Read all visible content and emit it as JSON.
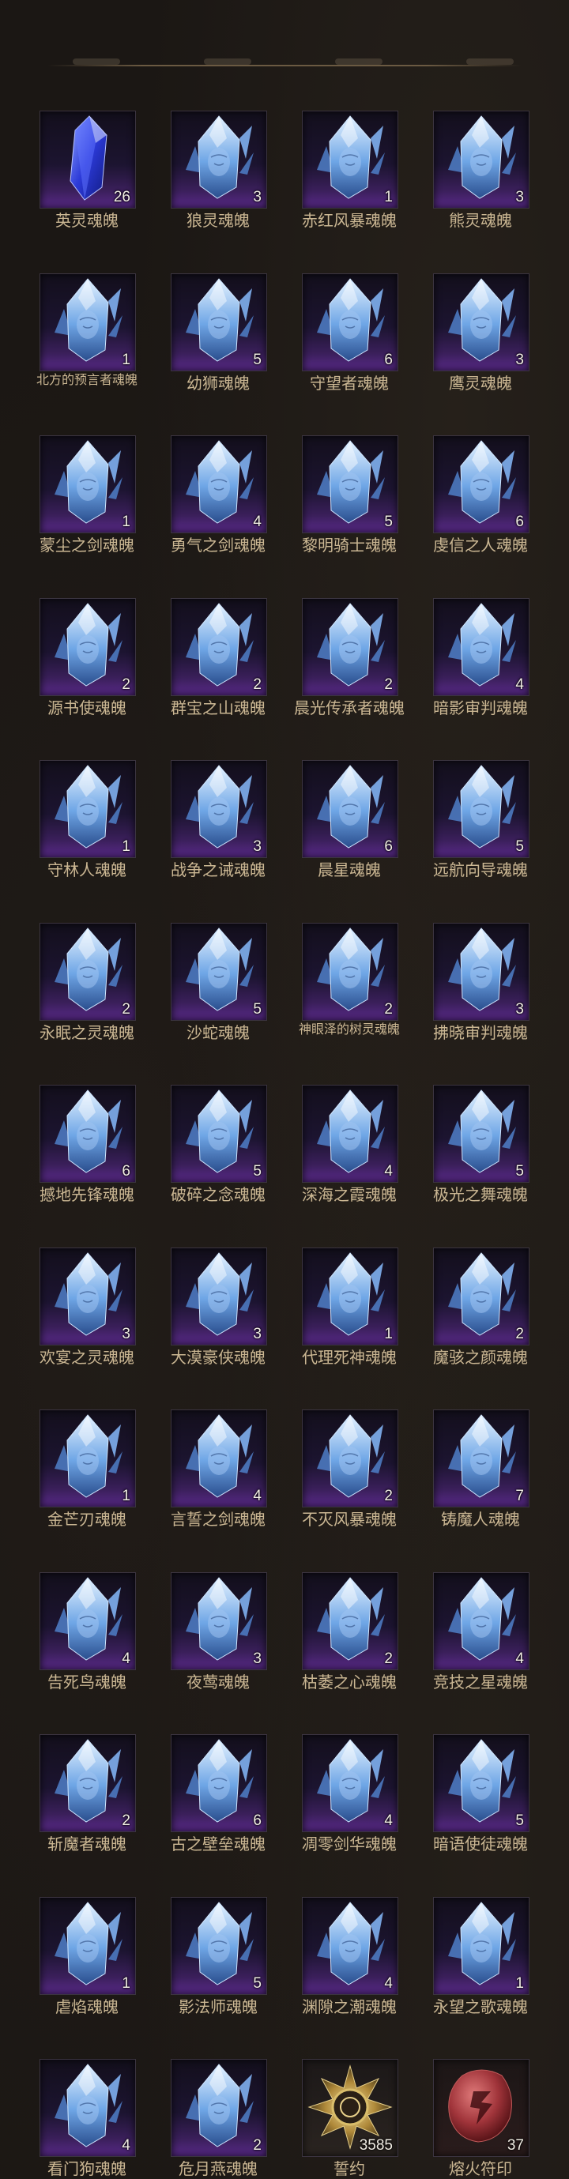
{
  "items": [
    {
      "name": "英灵魂魄",
      "count": "26",
      "icon": "soul-crystal-purple-icon",
      "type": "blue-crystal"
    },
    {
      "name": "狼灵魂魄",
      "count": "3",
      "icon": "soul-crystal-icon"
    },
    {
      "name": "赤红风暴魂魄",
      "count": "1",
      "icon": "soul-crystal-icon"
    },
    {
      "name": "熊灵魂魄",
      "count": "3",
      "icon": "soul-crystal-icon"
    },
    {
      "name": "北方的预言者魂魄",
      "count": "1",
      "icon": "soul-crystal-icon",
      "small": true
    },
    {
      "name": "幼狮魂魄",
      "count": "5",
      "icon": "soul-crystal-icon"
    },
    {
      "name": "守望者魂魄",
      "count": "6",
      "icon": "soul-crystal-icon"
    },
    {
      "name": "鹰灵魂魄",
      "count": "3",
      "icon": "soul-crystal-icon"
    },
    {
      "name": "蒙尘之剑魂魄",
      "count": "1",
      "icon": "soul-crystal-icon"
    },
    {
      "name": "勇气之剑魂魄",
      "count": "4",
      "icon": "soul-crystal-icon"
    },
    {
      "name": "黎明骑士魂魄",
      "count": "5",
      "icon": "soul-crystal-icon"
    },
    {
      "name": "虔信之人魂魄",
      "count": "6",
      "icon": "soul-crystal-icon"
    },
    {
      "name": "源书使魂魄",
      "count": "2",
      "icon": "soul-crystal-icon"
    },
    {
      "name": "群宝之山魂魄",
      "count": "2",
      "icon": "soul-crystal-icon"
    },
    {
      "name": "晨光传承者魂魄",
      "count": "2",
      "icon": "soul-crystal-icon"
    },
    {
      "name": "暗影审判魂魄",
      "count": "4",
      "icon": "soul-crystal-icon"
    },
    {
      "name": "守林人魂魄",
      "count": "1",
      "icon": "soul-crystal-icon"
    },
    {
      "name": "战争之诫魂魄",
      "count": "3",
      "icon": "soul-crystal-icon"
    },
    {
      "name": "晨星魂魄",
      "count": "6",
      "icon": "soul-crystal-icon"
    },
    {
      "name": "远航向导魂魄",
      "count": "5",
      "icon": "soul-crystal-icon"
    },
    {
      "name": "永眠之灵魂魄",
      "count": "2",
      "icon": "soul-crystal-icon"
    },
    {
      "name": "沙蛇魂魄",
      "count": "5",
      "icon": "soul-crystal-icon"
    },
    {
      "name": "神眼泽的树灵魂魄",
      "count": "2",
      "icon": "soul-crystal-icon",
      "small": true
    },
    {
      "name": "拂晓审判魂魄",
      "count": "3",
      "icon": "soul-crystal-icon"
    },
    {
      "name": "撼地先锋魂魄",
      "count": "6",
      "icon": "soul-crystal-icon"
    },
    {
      "name": "破碎之念魂魄",
      "count": "5",
      "icon": "soul-crystal-icon"
    },
    {
      "name": "深海之霞魂魄",
      "count": "4",
      "icon": "soul-crystal-icon"
    },
    {
      "name": "极光之舞魂魄",
      "count": "5",
      "icon": "soul-crystal-icon"
    },
    {
      "name": "欢宴之灵魂魄",
      "count": "3",
      "icon": "soul-crystal-icon"
    },
    {
      "name": "大漠豪侠魂魄",
      "count": "3",
      "icon": "soul-crystal-icon"
    },
    {
      "name": "代理死神魂魄",
      "count": "1",
      "icon": "soul-crystal-icon"
    },
    {
      "name": "魔骇之颜魂魄",
      "count": "2",
      "icon": "soul-crystal-icon"
    },
    {
      "name": "金芒刃魂魄",
      "count": "1",
      "icon": "soul-crystal-icon"
    },
    {
      "name": "言誓之剑魂魄",
      "count": "4",
      "icon": "soul-crystal-icon"
    },
    {
      "name": "不灭风暴魂魄",
      "count": "2",
      "icon": "soul-crystal-icon"
    },
    {
      "name": "铸魔人魂魄",
      "count": "7",
      "icon": "soul-crystal-icon"
    },
    {
      "name": "告死鸟魂魄",
      "count": "4",
      "icon": "soul-crystal-icon"
    },
    {
      "name": "夜莺魂魄",
      "count": "3",
      "icon": "soul-crystal-icon"
    },
    {
      "name": "枯萎之心魂魄",
      "count": "2",
      "icon": "soul-crystal-icon"
    },
    {
      "name": "竞技之星魂魄",
      "count": "4",
      "icon": "soul-crystal-icon"
    },
    {
      "name": "斩魔者魂魄",
      "count": "2",
      "icon": "soul-crystal-icon"
    },
    {
      "name": "古之壁垒魂魄",
      "count": "6",
      "icon": "soul-crystal-icon"
    },
    {
      "name": "凋零剑华魂魄",
      "count": "4",
      "icon": "soul-crystal-icon"
    },
    {
      "name": "暗语使徒魂魄",
      "count": "5",
      "icon": "soul-crystal-icon"
    },
    {
      "name": "虐焰魂魄",
      "count": "1",
      "icon": "soul-crystal-icon"
    },
    {
      "name": "影法师魂魄",
      "count": "5",
      "icon": "soul-crystal-icon"
    },
    {
      "name": "渊隙之潮魂魄",
      "count": "4",
      "icon": "soul-crystal-icon"
    },
    {
      "name": "永望之歌魂魄",
      "count": "1",
      "icon": "soul-crystal-icon"
    },
    {
      "name": "看门狗魂魄",
      "count": "4",
      "icon": "soul-crystal-icon"
    },
    {
      "name": "危月燕魂魄",
      "count": "2",
      "icon": "soul-crystal-icon"
    },
    {
      "name": "誓约",
      "count": "3585",
      "icon": "oath-medal-icon",
      "type": "gold"
    },
    {
      "name": "熔火符印",
      "count": "37",
      "icon": "molten-rune-icon",
      "type": "red"
    }
  ]
}
